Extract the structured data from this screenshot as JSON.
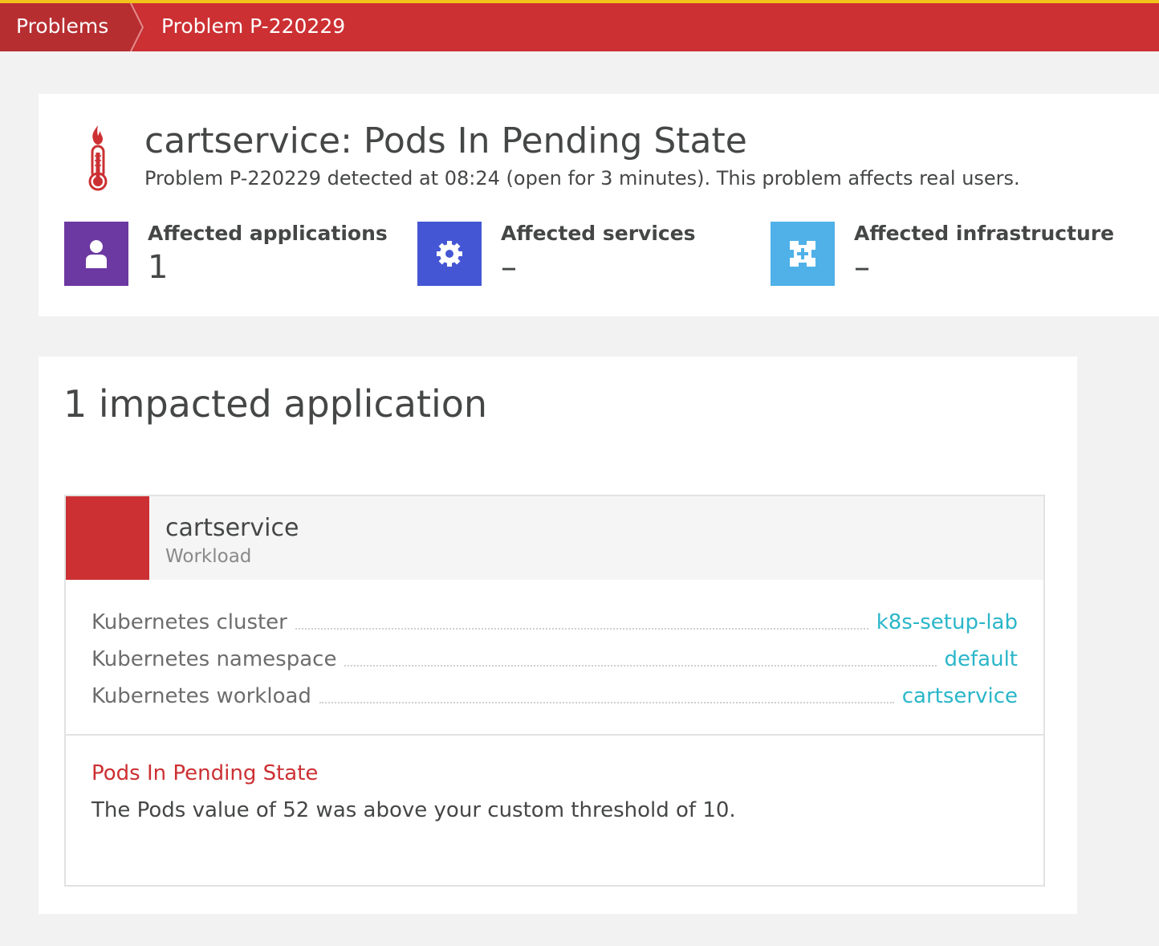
{
  "breadcrumb": {
    "items": [
      {
        "label": "Problems"
      },
      {
        "label": "Problem P-220229"
      }
    ]
  },
  "problem": {
    "title": "cartservice: Pods In Pending State",
    "subtitle": "Problem P-220229 detected at 08:24 (open for 3 minutes). This problem affects real users.",
    "icon": "thermometer-fire-icon"
  },
  "affected": {
    "applications": {
      "label": "Affected applications",
      "value": "1",
      "icon": "user-icon",
      "color": "#6c38a1"
    },
    "services": {
      "label": "Affected services",
      "value": "–",
      "icon": "gear-icon",
      "color": "#4556d4"
    },
    "infrastructure": {
      "label": "Affected infrastructure",
      "value": "–",
      "icon": "infrastructure-icon",
      "color": "#4fb1e8"
    }
  },
  "impact": {
    "title": "1 impacted application",
    "entity": {
      "name": "cartservice",
      "type": "Workload",
      "status_color": "#cc3033",
      "properties": [
        {
          "key": "Kubernetes cluster",
          "value": "k8s-setup-lab"
        },
        {
          "key": "Kubernetes namespace",
          "value": "default"
        },
        {
          "key": "Kubernetes workload",
          "value": "cartservice"
        }
      ],
      "event": {
        "title": "Pods In Pending State",
        "description": "The Pods value of 52 was above your custom threshold of 10."
      }
    }
  }
}
